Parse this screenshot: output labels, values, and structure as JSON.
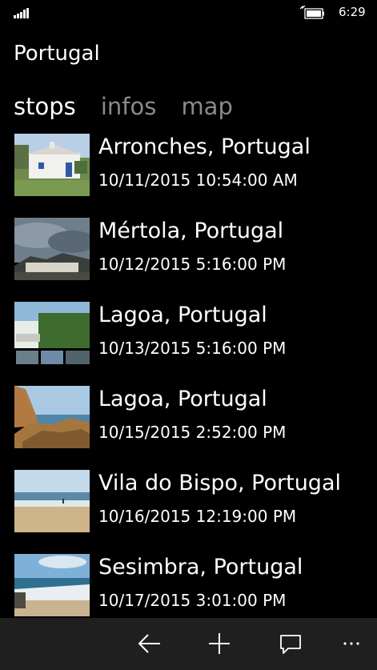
{
  "status_bar": {
    "time": "6:29",
    "icons": [
      "signal-strength-icon",
      "battery-charging-icon"
    ]
  },
  "app": {
    "title": "Portugal"
  },
  "pivot": {
    "tabs": [
      {
        "label": "stops",
        "active": true
      },
      {
        "label": "infos",
        "active": false
      },
      {
        "label": "map",
        "active": false
      }
    ]
  },
  "stops": [
    {
      "title": "Arronches, Portugal",
      "date": "10/11/2015 10:54:00 AM",
      "thumbnail": "white-farmhouse-photo"
    },
    {
      "title": "Mértola, Portugal",
      "date": "10/12/2015 5:16:00 PM",
      "thumbnail": "cloudy-hillside-village-photo"
    },
    {
      "title": "Lagoa, Portugal",
      "date": "10/13/2015 5:16:00 PM",
      "thumbnail": "villa-garden-collage-photo"
    },
    {
      "title": "Lagoa, Portugal",
      "date": "10/15/2015 2:52:00 PM",
      "thumbnail": "coastal-cliffs-photo"
    },
    {
      "title": "Vila do Bispo, Portugal",
      "date": "10/16/2015 12:19:00 PM",
      "thumbnail": "sandy-beach-photo"
    },
    {
      "title": "Sesimbra, Portugal",
      "date": "10/17/2015 3:01:00 PM",
      "thumbnail": "beach-waves-photo"
    }
  ],
  "app_bar": {
    "buttons": [
      "back-icon",
      "add-icon",
      "comment-icon",
      "more-icon"
    ]
  },
  "colors": {
    "background": "#000000",
    "inactive_tab": "#8a8a8a",
    "app_bar": "#1f1f1f"
  }
}
